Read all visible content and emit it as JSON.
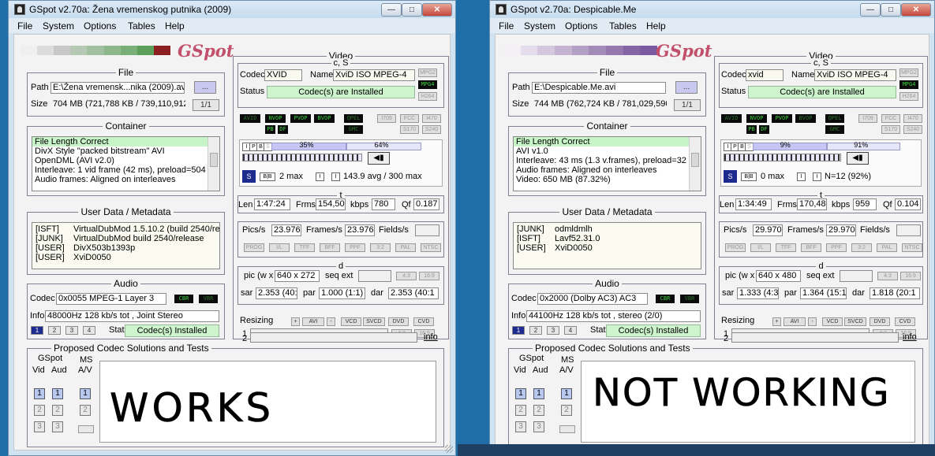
{
  "windows": [
    {
      "title": "GSpot v2.70a: Žena vremenskog putnika (2009)",
      "menu": [
        "File",
        "System",
        "Options",
        "Tables",
        "Help"
      ],
      "logo": "GSpot",
      "file": {
        "group_title": "File",
        "path_label": "Path",
        "path_value": "E:\\Žena vremensk...nika (2009).avi",
        "browse_label": "...",
        "size_label": "Size",
        "size_value": "704 MB (721,788 KB / 739,110,912",
        "page": "1/1"
      },
      "container": {
        "group_title": "Container",
        "rows": [
          "File Length Correct",
          "DivX Style \"packed bitstream\" AVI",
          "OpenDML (AVI v2.0)",
          "Interleave: 1 vid frame (42 ms), preload=504",
          "Audio frames: Aligned on interleaves"
        ]
      },
      "metadata": {
        "group_title": "User Data / Metadata",
        "rows": [
          {
            "key": "[ISFT]",
            "value": "VirtualDubMod 1.5.10.2 (build 2540/rele"
          },
          {
            "key": "[JUNK]",
            "value": "VirtualDubMod build 2540/release"
          },
          {
            "key": "[USER]",
            "value": "DivX503b1393p"
          },
          {
            "key": "[USER]",
            "value": "XviD0050"
          }
        ]
      },
      "audio": {
        "group_title": "Audio",
        "codec_label": "Codec",
        "codec_value": "0x0055 MPEG-1 Layer 3",
        "cbr": "CBR",
        "vbr": "VBR",
        "info_label": "Info",
        "info_value": "48000Hz  128 kb/s tot , Joint Stereo",
        "tracks": [
          "1",
          "2",
          "3",
          "4"
        ],
        "stat_label": "Stat",
        "stat_value": "Codec(s) Installed"
      },
      "proposed": {
        "group_title": "Proposed Codec Solutions and Tests",
        "gspot_label": "GSpot",
        "vid_label": "Vid",
        "aud_label": "Aud",
        "ms_label": "MS",
        "av_label": "A/V",
        "handwriting": "WORKS"
      },
      "video": {
        "group_title": "Video",
        "cs_label": "c, S",
        "codec_label": "Codec",
        "codec_value": "XVID",
        "name_label": "Name",
        "name_value": "XviD ISO MPEG-4",
        "status_label": "Status",
        "status_value": "Codec(s) are Installed",
        "std_tags": [
          "MPG2",
          "MPG4",
          "H264"
        ],
        "flag_tags": [
          "AVID",
          "NVOP",
          "PVOP",
          "BVOP",
          "QPEL",
          "GMC",
          "PB",
          "DF"
        ],
        "right_tags": [
          "I709",
          "FCC",
          "I470",
          "S170",
          "S240"
        ],
        "frame_types": [
          "I",
          "P",
          "B",
          "S"
        ],
        "pct1": "35%",
        "pct2": "64%",
        "pct1_value": 35,
        "pct2_value": 64,
        "b_frames": "2 max",
        "bitrate_text": "143.9 avg / 300 max",
        "len_label": "Len",
        "len_value": "1:47:24",
        "frms_label": "Frms",
        "frms_value": "154,50",
        "kbps_label": "kbps",
        "kbps_value": "780",
        "qf_label": "Qf",
        "qf_value": "0.187",
        "pics_label": "Pics/s",
        "pics_value": "23.976",
        "frames_label": "Frames/s",
        "frames_value": "23.976",
        "fields_label": "Fields/s",
        "flags_row": [
          "PROG",
          "I/L",
          "TFF",
          "BFF",
          "PPF",
          "3:2",
          "PAL",
          "NTSC"
        ],
        "d_label": "d",
        "pic_label": "pic (w x",
        "pic_value": "640 x 272",
        "seq_label": "seq ext",
        "ar1": "4:3",
        "ar2": "16:9",
        "sar_label": "sar",
        "sar_value": "2.353 (40:1",
        "par_label": "par",
        "par_value": "1.000 (1:1)",
        "dar_label": "dar",
        "dar_value": "2.353 (40:1",
        "resizing_label": "Resizing",
        "resize_btns": [
          "+",
          "AVI",
          "-",
          "VCD",
          "SVCD",
          "DVD",
          "CVD"
        ],
        "row1": "1",
        "row2": "2",
        "info_link": "info"
      }
    },
    {
      "title": "GSpot v2.70a: Despicable.Me",
      "menu": [
        "File",
        "System",
        "Options",
        "Tables",
        "Help"
      ],
      "logo": "GSpot",
      "file": {
        "group_title": "File",
        "path_label": "Path",
        "path_value": "E:\\Despicable.Me.avi",
        "browse_label": "...",
        "size_label": "Size",
        "size_value": "744 MB (762,724 KB / 781,029,590",
        "page": "1/1"
      },
      "container": {
        "group_title": "Container",
        "rows": [
          "File Length Correct",
          "AVI v1.0",
          "Interleave: 43 ms (1.3 v.frames), preload=32",
          "Audio frames: Aligned on interleaves",
          "Video: 650 MB (87.32%)"
        ]
      },
      "metadata": {
        "group_title": "User Data / Metadata",
        "rows": [
          {
            "key": "[JUNK]",
            "value": "odmldmlh"
          },
          {
            "key": "[ISFT]",
            "value": "Lavf52.31.0"
          },
          {
            "key": "[USER]",
            "value": "XviD0050"
          }
        ]
      },
      "audio": {
        "group_title": "Audio",
        "codec_label": "Codec",
        "codec_value": "0x2000 (Dolby AC3) AC3",
        "cbr": "CBR",
        "vbr": "VBR",
        "info_label": "Info",
        "info_value": "44100Hz  128 kb/s tot , stereo (2/0)",
        "tracks": [
          "1",
          "2",
          "3",
          "4"
        ],
        "stat_label": "Stat",
        "stat_value": "Codec(s) Installed"
      },
      "proposed": {
        "group_title": "Proposed Codec Solutions and Tests",
        "gspot_label": "GSpot",
        "vid_label": "Vid",
        "aud_label": "Aud",
        "ms_label": "MS",
        "av_label": "A/V",
        "handwriting": "NOT WORKING"
      },
      "video": {
        "group_title": "Video",
        "cs_label": "c, S",
        "codec_label": "Codec",
        "codec_value": "xvid",
        "name_label": "Name",
        "name_value": "XviD ISO MPEG-4",
        "status_label": "Status",
        "status_value": "Codec(s) are Installed",
        "std_tags": [
          "MPG2",
          "MPG4",
          "H264"
        ],
        "flag_tags": [
          "AVID",
          "NVOP",
          "PVOP",
          "BVOP",
          "QPEL",
          "GMC",
          "PB",
          "DF"
        ],
        "right_tags": [
          "I709",
          "FCC",
          "I470",
          "S170",
          "S240"
        ],
        "frame_types": [
          "I",
          "P",
          "B",
          "S"
        ],
        "pct1": "9%",
        "pct2": "91%",
        "pct1_value": 9,
        "pct2_value": 91,
        "b_frames": "0 max",
        "bitrate_text": "N=12 (92%)",
        "len_label": "Len",
        "len_value": "1:34:49",
        "frms_label": "Frms",
        "frms_value": "170,48",
        "kbps_label": "kbps",
        "kbps_value": "959",
        "qf_label": "Qf",
        "qf_value": "0.104",
        "pics_label": "Pics/s",
        "pics_value": "29.970",
        "frames_label": "Frames/s",
        "frames_value": "29.970",
        "fields_label": "Fields/s",
        "flags_row": [
          "PROG",
          "I/L",
          "TFF",
          "BFF",
          "PPF",
          "3:2",
          "PAL",
          "NTSC"
        ],
        "d_label": "d",
        "pic_label": "pic (w x",
        "pic_value": "640 x 480",
        "seq_label": "seq ext",
        "ar1": "4:3",
        "ar2": "16:9",
        "sar_label": "sar",
        "sar_value": "1.333 (4:3)",
        "par_label": "par",
        "par_value": "1.364 (15:1",
        "dar_label": "dar",
        "dar_value": "1.818 (20:1",
        "resizing_label": "Resizing",
        "resize_btns": [
          "+",
          "AVI",
          "-",
          "VCD",
          "SVCD",
          "DVD",
          "CVD"
        ],
        "row1": "1",
        "row2": "2",
        "info_link": "info"
      }
    }
  ]
}
